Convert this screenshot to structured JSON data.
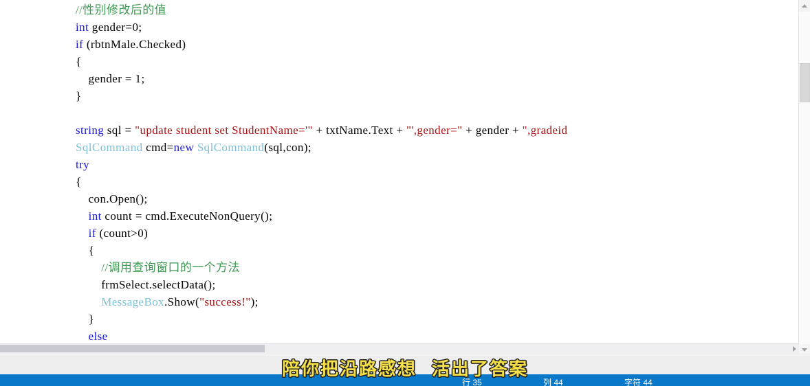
{
  "editor": {
    "lines": [
      [
        {
          "t": "c",
          "v": "//性别修改后的值"
        }
      ],
      [
        {
          "t": "k",
          "v": "int"
        },
        {
          "t": "p",
          "v": " gender=0;"
        }
      ],
      [
        {
          "t": "k",
          "v": "if"
        },
        {
          "t": "p",
          "v": " (rbtnMale.Checked)"
        }
      ],
      [
        {
          "t": "p",
          "v": "{"
        }
      ],
      [
        {
          "t": "p",
          "v": "    gender = 1;"
        }
      ],
      [
        {
          "t": "p",
          "v": "}"
        }
      ],
      [
        {
          "t": "p",
          "v": ""
        }
      ],
      [
        {
          "t": "k",
          "v": "string"
        },
        {
          "t": "p",
          "v": " sql = "
        },
        {
          "t": "s",
          "v": "\"update student set StudentName='\""
        },
        {
          "t": "p",
          "v": " + txtName.Text + "
        },
        {
          "t": "s",
          "v": "\"',gender=\""
        },
        {
          "t": "p",
          "v": " + gender + "
        },
        {
          "t": "s",
          "v": "\",gradeid"
        }
      ],
      [
        {
          "t": "t",
          "v": "SqlCommand"
        },
        {
          "t": "p",
          "v": " cmd="
        },
        {
          "t": "k",
          "v": "new"
        },
        {
          "t": "p",
          "v": " "
        },
        {
          "t": "t",
          "v": "SqlCommand"
        },
        {
          "t": "p",
          "v": "(sql,con);"
        }
      ],
      [
        {
          "t": "k",
          "v": "try"
        }
      ],
      [
        {
          "t": "p",
          "v": "{"
        }
      ],
      [
        {
          "t": "p",
          "v": "    con.Open();"
        }
      ],
      [
        {
          "t": "k",
          "v": "    int"
        },
        {
          "t": "p",
          "v": " count = cmd.ExecuteNonQuery();"
        }
      ],
      [
        {
          "t": "k",
          "v": "    if"
        },
        {
          "t": "p",
          "v": " (count>0)"
        }
      ],
      [
        {
          "t": "p",
          "v": "    {"
        }
      ],
      [
        {
          "t": "c",
          "v": "        //调用查询窗口的一个方法"
        }
      ],
      [
        {
          "t": "p",
          "v": "        frmSelect.selectData();"
        }
      ],
      [
        {
          "t": "p",
          "v": "        "
        },
        {
          "t": "t",
          "v": "MessageBox"
        },
        {
          "t": "p",
          "v": ".Show("
        },
        {
          "t": "s",
          "v": "\"success!\""
        },
        {
          "t": "p",
          "v": ");"
        }
      ],
      [
        {
          "t": "p",
          "v": "    }"
        }
      ],
      [
        {
          "t": "k",
          "v": "    else"
        }
      ]
    ]
  },
  "scrollbars": {
    "vertical_up_icon": "triangle-up-icon",
    "vertical_down_icon": "triangle-down-icon",
    "horizontal_right_icon": "triangle-right-icon"
  },
  "status": {
    "ready": "",
    "line": "行 35",
    "column": "列 44",
    "character": "字符 44",
    "insert": ""
  },
  "subtitle": {
    "text": "陪你把沿路感想  活出了答案"
  },
  "colors": {
    "keyword": "#1a1ad6",
    "type": "#7fc2d8",
    "string": "#a31515",
    "comment": "#3f9a54",
    "statusbar": "#0a78c8",
    "subtitle_fill": "#f5e04a"
  }
}
